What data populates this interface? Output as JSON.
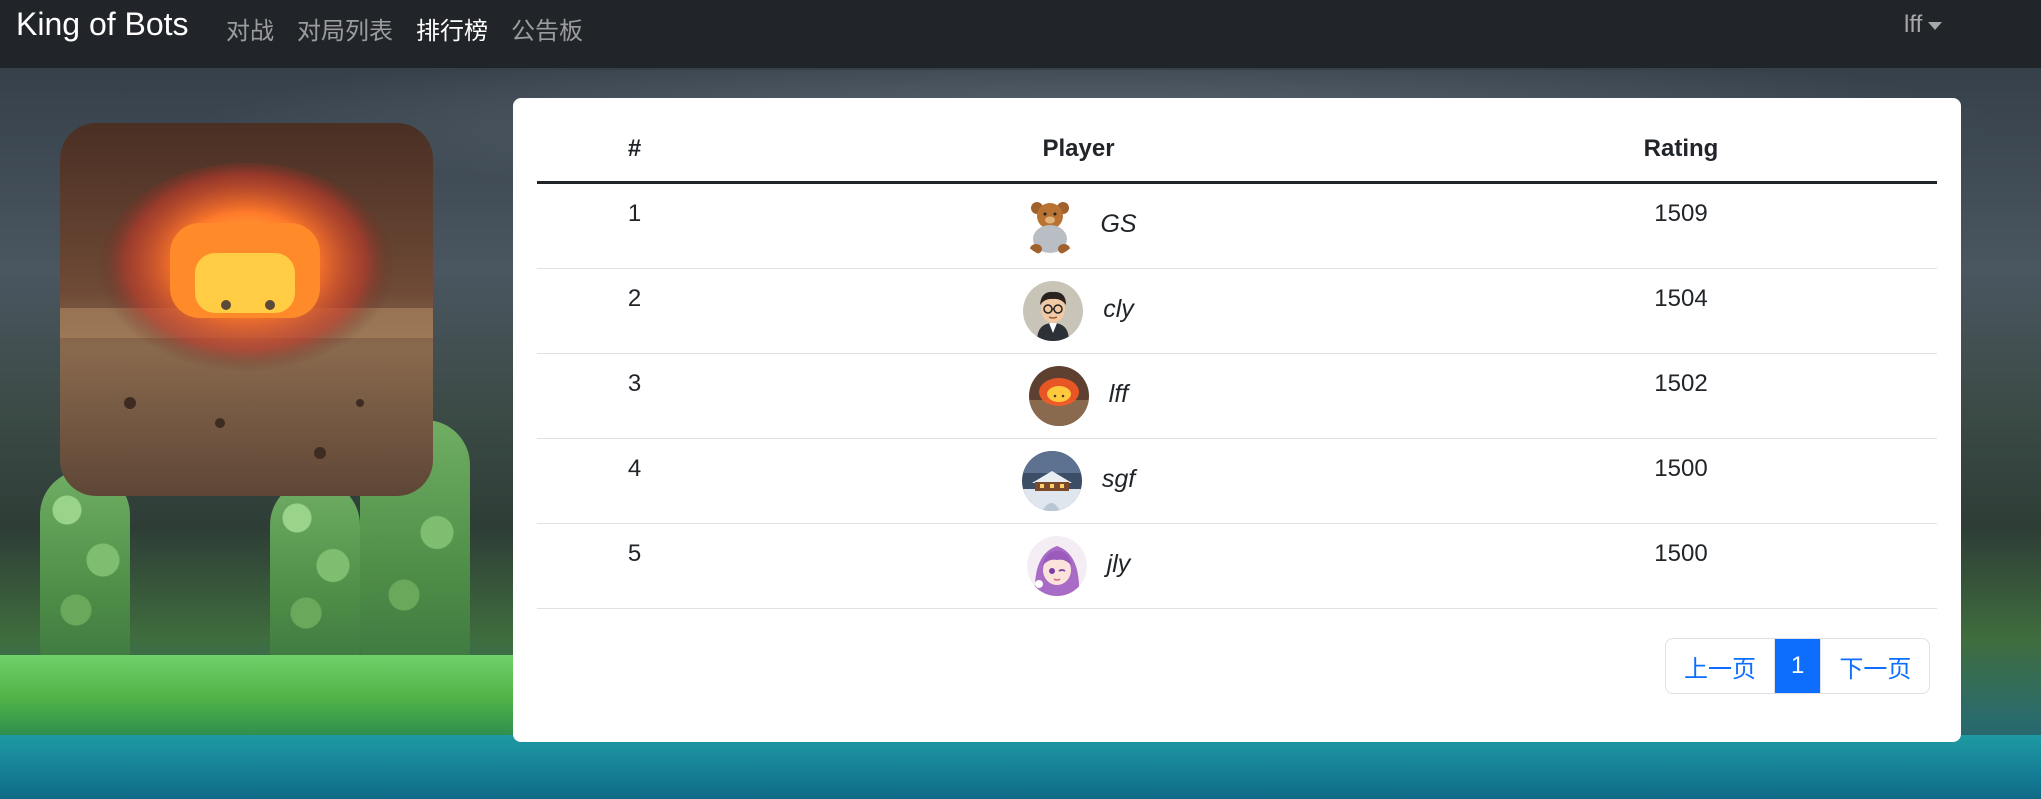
{
  "nav": {
    "brand": "King of Bots",
    "links": [
      {
        "label": "对战"
      },
      {
        "label": "对局列表"
      },
      {
        "label": "排行榜",
        "active": true
      },
      {
        "label": "公告板"
      }
    ],
    "user": "lff"
  },
  "ranklist": {
    "headers": {
      "rank": "#",
      "player": "Player",
      "rating": "Rating"
    },
    "rows": [
      {
        "rank": "1",
        "player": "GS",
        "rating": "1509",
        "avatar": "teddy-bear-avatar"
      },
      {
        "rank": "2",
        "player": "cly",
        "rating": "1504",
        "avatar": "cartoon-man-avatar"
      },
      {
        "rank": "3",
        "player": "lff",
        "rating": "1502",
        "avatar": "calcifer-fire-avatar"
      },
      {
        "rank": "4",
        "player": "sgf",
        "rating": "1500",
        "avatar": "snowy-house-avatar"
      },
      {
        "rank": "5",
        "player": "jly",
        "rating": "1500",
        "avatar": "anime-girl-avatar"
      }
    ]
  },
  "pagination": {
    "prev": "上一页",
    "current": "1",
    "next": "下一页"
  },
  "colors": {
    "navbar": "#212529",
    "primary": "#0d6efd",
    "card": "#ffffff"
  }
}
